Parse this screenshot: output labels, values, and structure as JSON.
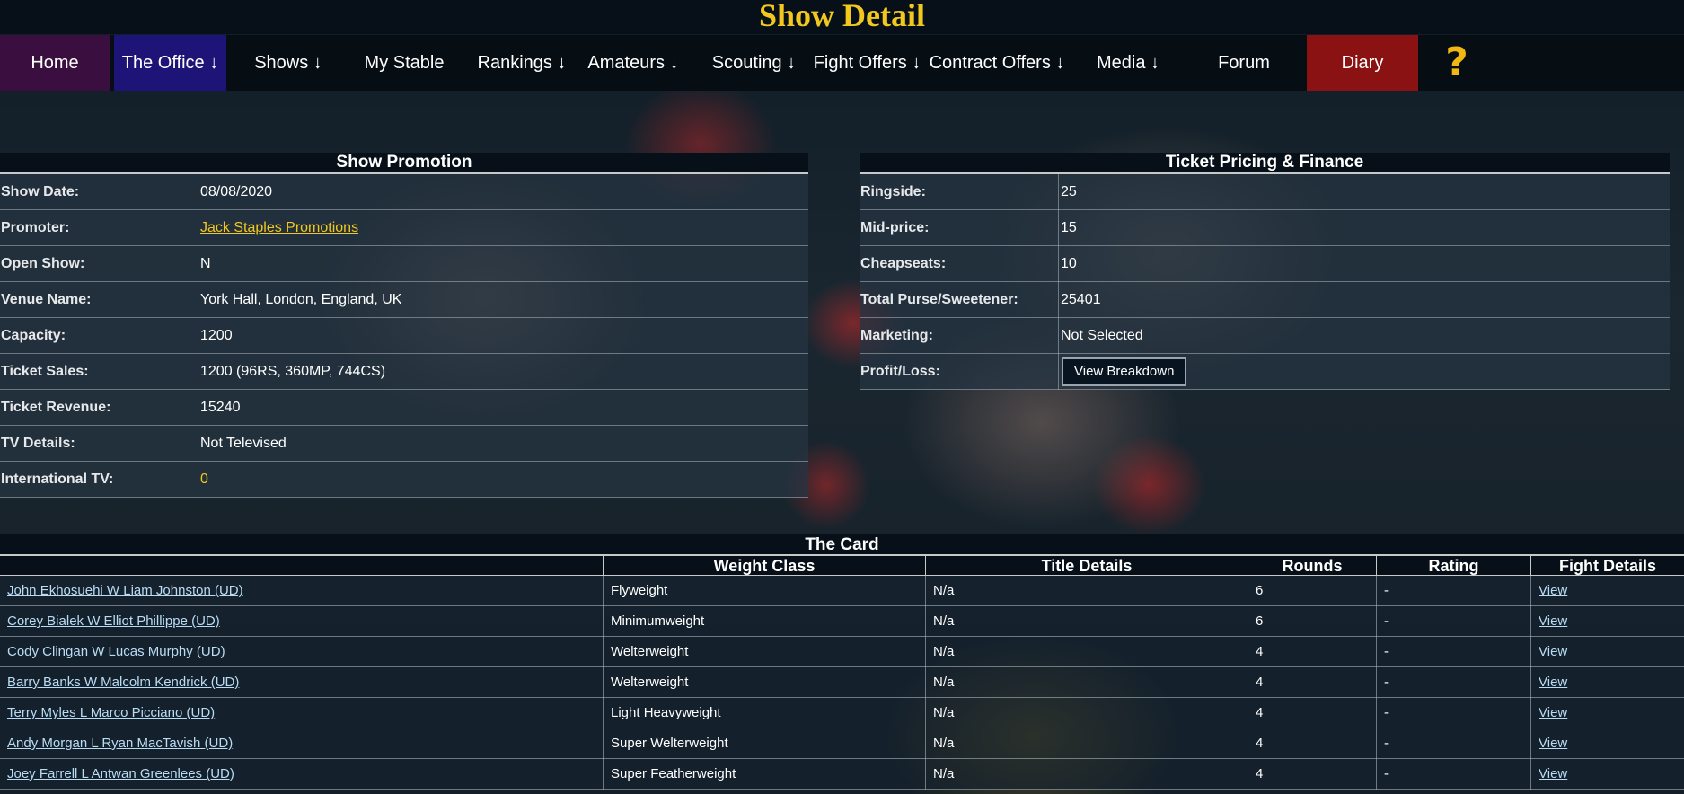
{
  "page": {
    "title": "Show Detail"
  },
  "nav": {
    "items": [
      {
        "label": "Home",
        "bg": "#3a0e3f"
      },
      {
        "label": "The Office ↓",
        "bg": "#1e1477"
      },
      {
        "label": "Shows ↓"
      },
      {
        "label": "My Stable"
      },
      {
        "label": "Rankings ↓"
      },
      {
        "label": "Amateurs ↓"
      },
      {
        "label": "Scouting ↓"
      },
      {
        "label": "Fight Offers ↓"
      },
      {
        "label": "Contract Offers ↓"
      },
      {
        "label": "Media ↓"
      },
      {
        "label": "Forum"
      },
      {
        "label": "Diary",
        "bg": "#8a1212"
      }
    ],
    "help_icon": "?"
  },
  "promotion": {
    "title": "Show Promotion",
    "rows": [
      {
        "label": "Show Date:",
        "value": "08/08/2020"
      },
      {
        "label": "Promoter:",
        "value": "Jack Staples Promotions"
      },
      {
        "label": "Open Show:",
        "value": "N"
      },
      {
        "label": "Venue Name:",
        "value": "York Hall, London, England, UK"
      },
      {
        "label": "Capacity:",
        "value": "1200"
      },
      {
        "label": "Ticket Sales:",
        "value": "1200 (96RS, 360MP, 744CS)"
      },
      {
        "label": "Ticket Revenue:",
        "value": "15240"
      },
      {
        "label": "TV Details:",
        "value": "Not Televised"
      },
      {
        "label": "International TV:",
        "value": "0"
      }
    ]
  },
  "finance": {
    "title": "Ticket Pricing & Finance",
    "rows": [
      {
        "label": "Ringside:",
        "value": "25"
      },
      {
        "label": "Mid-price:",
        "value": "15"
      },
      {
        "label": "Cheapseats:",
        "value": "10"
      },
      {
        "label": "Total Purse/Sweetener:",
        "value": "25401"
      },
      {
        "label": "Marketing:",
        "value": "Not Selected"
      },
      {
        "label": "Profit/Loss:",
        "button": "View Breakdown"
      }
    ]
  },
  "card": {
    "title": "The Card",
    "headers": [
      "",
      "Weight Class",
      "Title Details",
      "Rounds",
      "Rating",
      "Fight Details"
    ],
    "rows": [
      {
        "bout": "John Ekhosuehi W Liam Johnston (UD)",
        "weight": "Flyweight",
        "title": "N/a",
        "rounds": "6",
        "rating": "-",
        "details": "View"
      },
      {
        "bout": "Corey Bialek W Elliot Phillippe (UD)",
        "weight": "Minimumweight",
        "title": "N/a",
        "rounds": "6",
        "rating": "-",
        "details": "View"
      },
      {
        "bout": "Cody Clingan W Lucas Murphy (UD)",
        "weight": "Welterweight",
        "title": "N/a",
        "rounds": "4",
        "rating": "-",
        "details": "View"
      },
      {
        "bout": "Barry Banks W Malcolm Kendrick (UD)",
        "weight": "Welterweight",
        "title": "N/a",
        "rounds": "4",
        "rating": "-",
        "details": "View"
      },
      {
        "bout": "Terry Myles L Marco Picciano (UD)",
        "weight": "Light Heavyweight",
        "title": "N/a",
        "rounds": "4",
        "rating": "-",
        "details": "View"
      },
      {
        "bout": "Andy Morgan L Ryan MacTavish (UD)",
        "weight": "Super Welterweight",
        "title": "N/a",
        "rounds": "4",
        "rating": "-",
        "details": "View"
      },
      {
        "bout": "Joey Farrell L Antwan Greenlees (UD)",
        "weight": "Super Featherweight",
        "title": "N/a",
        "rounds": "4",
        "rating": "-",
        "details": "View"
      }
    ]
  },
  "colors": {
    "accent_yellow": "#f3c81e",
    "link_blue": "#b9dcf5",
    "header_bg": "#071018"
  }
}
